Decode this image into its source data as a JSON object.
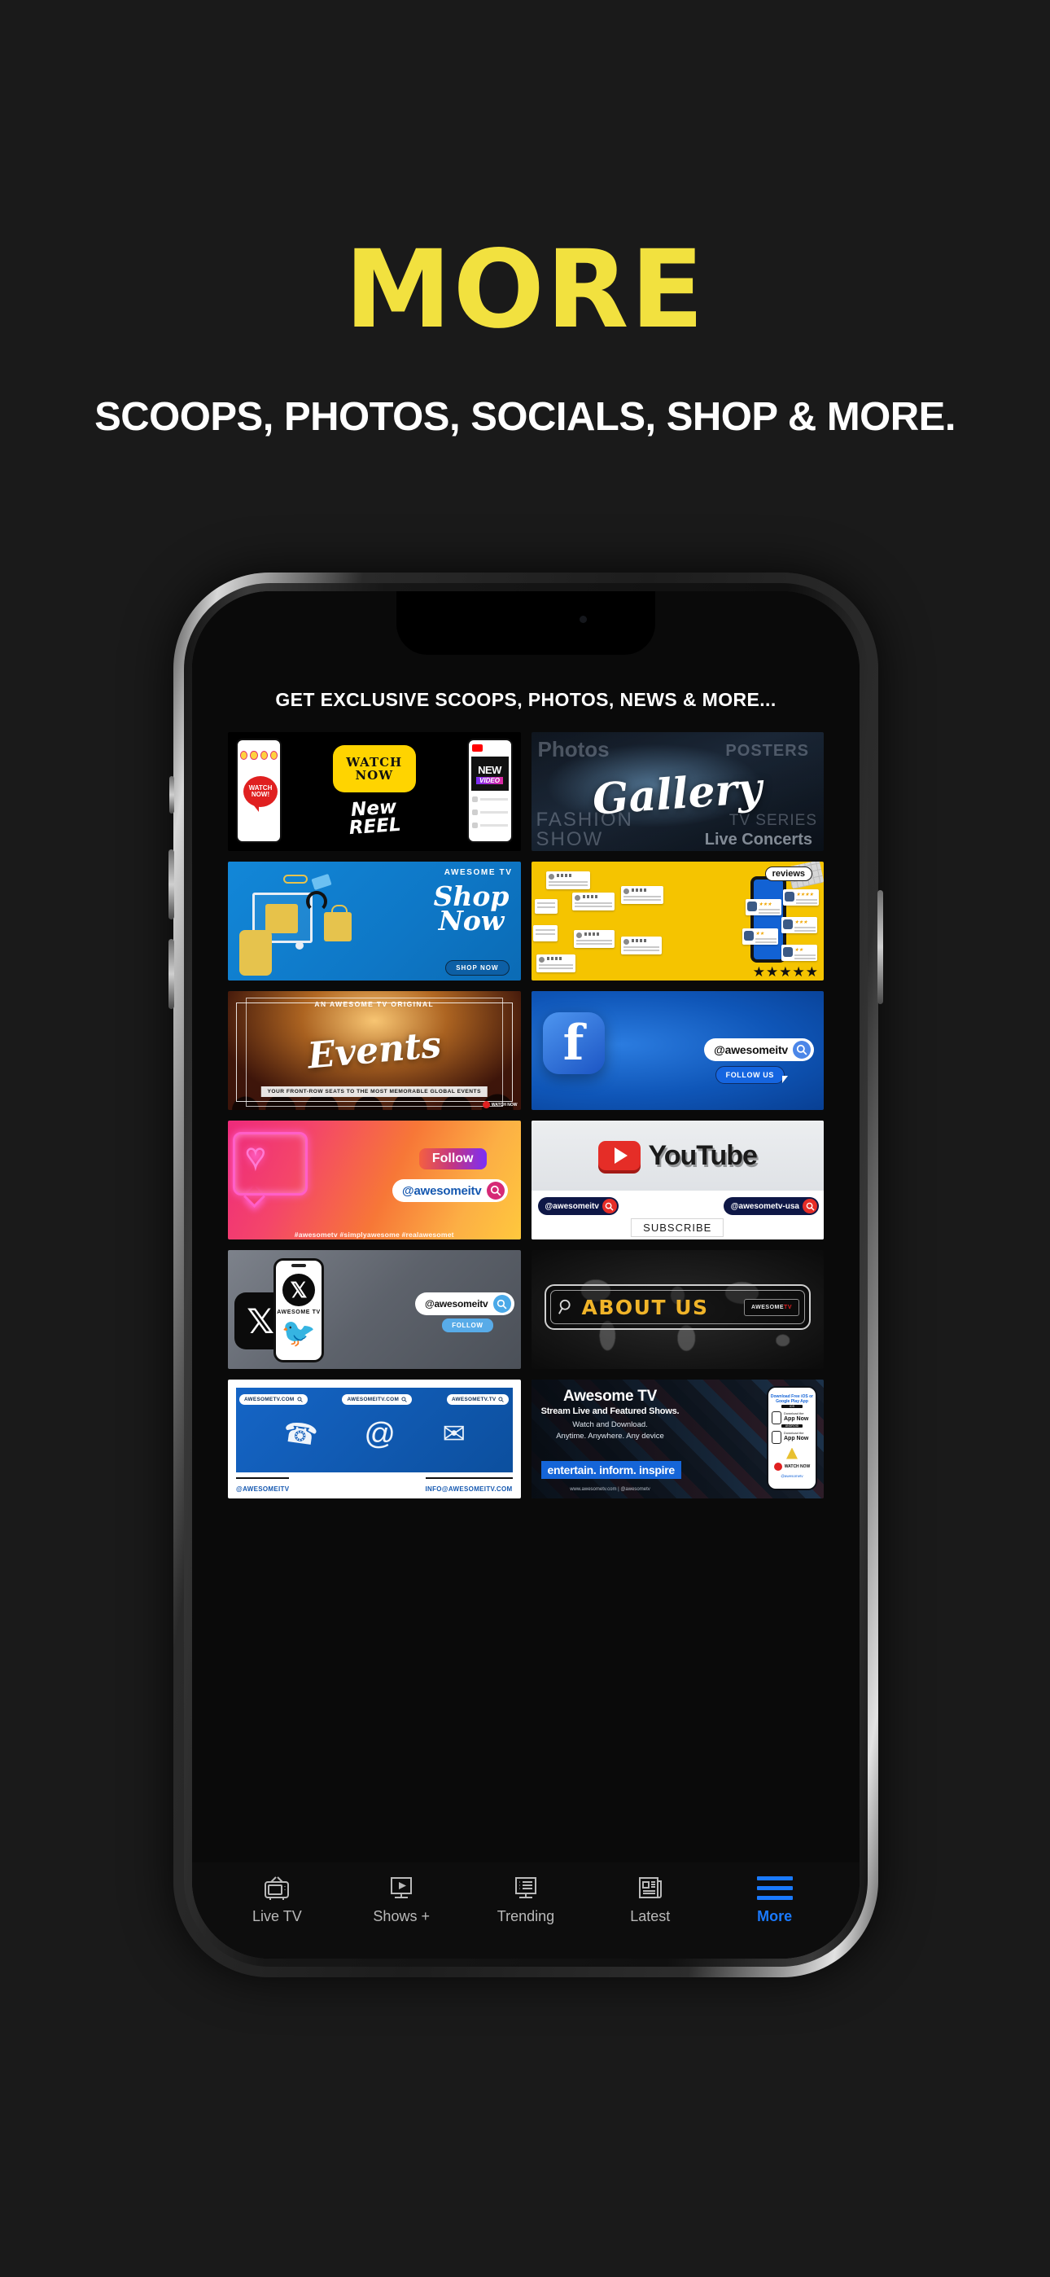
{
  "headline": {
    "title": "MORE",
    "subtitle": "SCOOPS, PHOTOS, SOCIALS, SHOP & MORE.",
    "title_color": "#f2e13f",
    "background_color": "#1a1a1a"
  },
  "app": {
    "header": "GET EXCLUSIVE SCOOPS, PHOTOS, NEWS & MORE...",
    "accent_color": "#1a7aff"
  },
  "tiles": [
    {
      "name": "watch-now-new-reel",
      "badge_line1": "WATCH",
      "badge_line2": "NOW",
      "script_line1": "New",
      "script_line2": "REEL",
      "bubble_line1": "WATCH",
      "bubble_line2": "NOW!",
      "video_line1": "NEW",
      "video_line2": "VIDEO"
    },
    {
      "name": "photos-gallery",
      "script": "Gallery",
      "ghost_words": [
        "Photos",
        "POSTERS",
        "FASHION",
        "SHOW",
        "TV SERIES",
        "Live Concerts"
      ]
    },
    {
      "name": "shop-now",
      "brand": "AWESOME TV",
      "script_line1": "Shop",
      "script_line2": "Now",
      "cta": "SHOP NOW"
    },
    {
      "name": "reviews",
      "chip": "reviews",
      "stars": "★★★★★"
    },
    {
      "name": "events",
      "kicker": "AN AWESOME TV ORIGINAL",
      "script": "Events",
      "strapline": "YOUR FRONT-ROW SEATS TO THE MOST MEMORABLE GLOBAL EVENTS",
      "watch_now": "WATCH NOW"
    },
    {
      "name": "facebook",
      "logo": "f",
      "handle": "@awesomeitv",
      "cta": "FOLLOW US"
    },
    {
      "name": "instagram",
      "follow": "Follow",
      "handle": "@awesomeitv",
      "hashtags": "#awesometv  #simplyawesome  #realawesomet"
    },
    {
      "name": "youtube",
      "wordmark": "YouTube",
      "handle1": "@awesomeitv",
      "handle2": "@awesometv-usa",
      "cta": "SUBSCRIBE"
    },
    {
      "name": "x-twitter",
      "mark": "𝕏",
      "phone_label": "AWESOME TV",
      "handle": "@awesomeitv",
      "cta": "FOLLOW"
    },
    {
      "name": "about-us",
      "title": "ABOUT US",
      "logo_word1": "AWESOME",
      "logo_word2": "TV"
    },
    {
      "name": "contact",
      "url1": "AWESOMETV.COM",
      "url2": "AWESOMEITV.COM",
      "url3": "AWESOMETV.TV",
      "foot1": "@AWESOMEITV",
      "foot2": "INFO@AWESOMEITV.COM"
    },
    {
      "name": "awesome-tv-promo",
      "title": "Awesome TV",
      "subtitle": "Stream Live and Featured Shows.",
      "line3": "Watch and Download.",
      "line4": "Anytime. Anywhere. Any device",
      "tagline": "entertain. inform. inspire",
      "url": "www.awesometv.com | @awesometv",
      "mini_header": "Download Free iOS or Google Play App",
      "mini_cap1": "iOS",
      "mini_cap2": "ANDROID",
      "mini_small1": "Download the",
      "mini_big1": "App Now",
      "mini_small2": "Download the",
      "mini_big2": "App Now",
      "mini_watch": "WATCH NOW",
      "mini_handle": "@awesometv"
    }
  ],
  "tabbar": [
    {
      "label": "Live TV",
      "icon": "tv-icon",
      "active": false
    },
    {
      "label": "Shows +",
      "icon": "monitor-play-icon",
      "active": false
    },
    {
      "label": "Trending",
      "icon": "list-screen-icon",
      "active": false
    },
    {
      "label": "Latest",
      "icon": "newspaper-icon",
      "active": false
    },
    {
      "label": "More",
      "icon": "hamburger-icon",
      "active": true
    }
  ]
}
